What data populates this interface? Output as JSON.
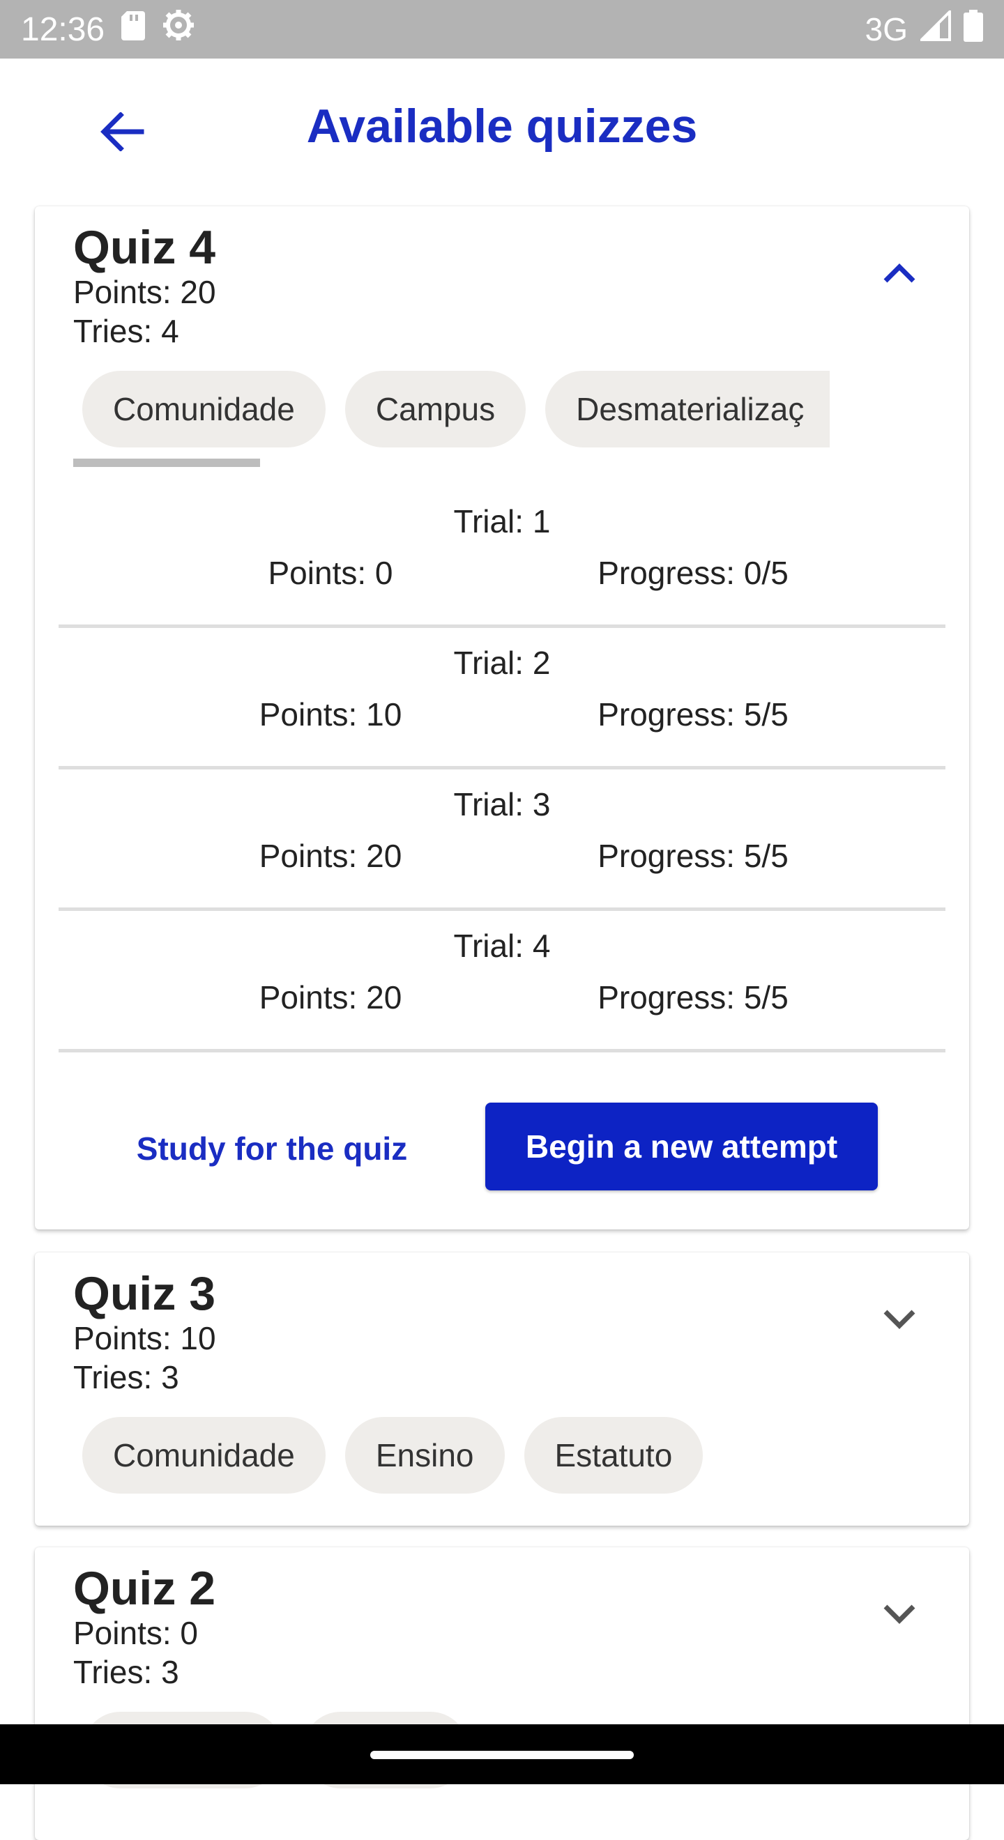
{
  "status_bar": {
    "time": "12:36",
    "network": "3G",
    "icons": [
      "sd-card-icon",
      "settings-icon",
      "signal-icon",
      "battery-icon"
    ]
  },
  "header": {
    "title": "Available quizzes",
    "back_icon": "arrow-left-icon"
  },
  "colors": {
    "accent": "#1a2dc2",
    "button": "#0d23c4",
    "chip_bg": "#efedea",
    "status_bar": "#b3b3b3"
  },
  "quizzes": [
    {
      "title": "Quiz 4",
      "points": "Points: 20",
      "tries": "Tries: 4",
      "expanded": true,
      "chips": [
        "Comunidade",
        "Campus",
        "Desmaterializaç"
      ],
      "trials": [
        {
          "trial": "Trial: 1",
          "points": "Points: 0",
          "progress": "Progress: 0/5"
        },
        {
          "trial": "Trial: 2",
          "points": "Points: 10",
          "progress": "Progress: 5/5"
        },
        {
          "trial": "Trial: 3",
          "points": "Points: 20",
          "progress": "Progress: 5/5"
        },
        {
          "trial": "Trial: 4",
          "points": "Points: 20",
          "progress": "Progress: 5/5"
        }
      ],
      "study_label": "Study for the quiz",
      "begin_label": "Begin a new attempt"
    },
    {
      "title": "Quiz 3",
      "points": "Points: 10",
      "tries": "Tries: 3",
      "expanded": false,
      "chips": [
        "Comunidade",
        "Ensino",
        "Estatuto"
      ]
    },
    {
      "title": "Quiz 2",
      "points": "Points: 0",
      "tries": "Tries: 3",
      "expanded": false
    }
  ]
}
